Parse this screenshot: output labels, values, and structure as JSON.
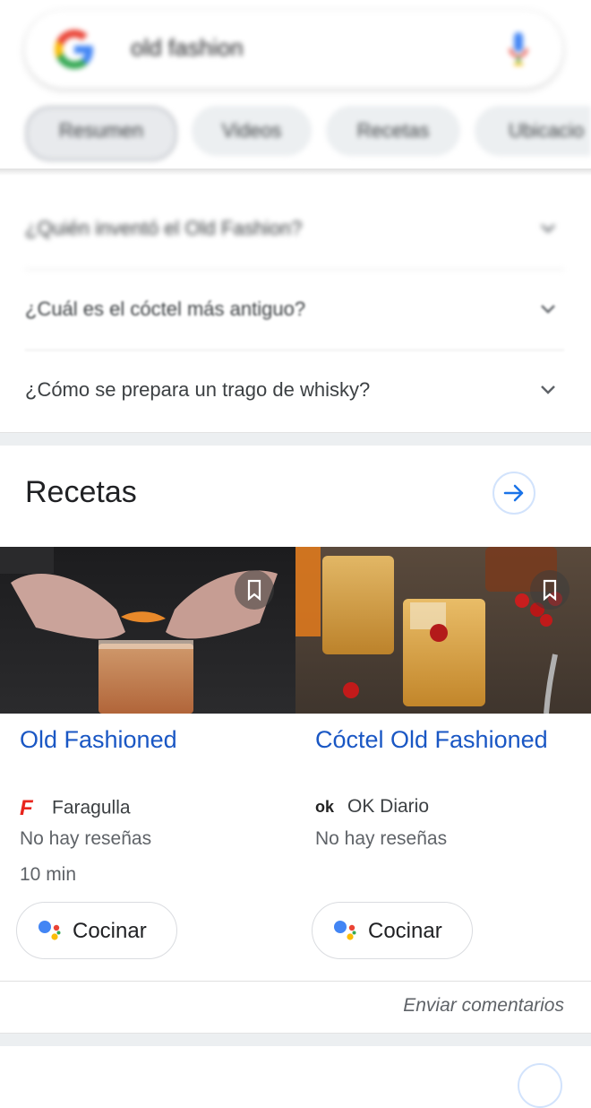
{
  "search": {
    "query": "old fashion"
  },
  "chips": [
    "Resumen",
    "Videos",
    "Recetas",
    "Ubicacio"
  ],
  "faq": [
    "¿Quién inventó el Old Fashion?",
    "¿Cuál es el cóctel más antiguo?",
    "¿Cómo se prepara un trago de whisky?"
  ],
  "recipes": {
    "title": "Recetas",
    "cards": [
      {
        "title": "Old Fashioned",
        "source": "Faragulla",
        "reviews": "No hay reseñas",
        "time": "10 min",
        "button": "Cocinar",
        "logo_text": "F"
      },
      {
        "title": "Cóctel Old Fashioned",
        "source": "OK Diario",
        "reviews": "No hay reseñas",
        "time": "",
        "button": "Cocinar",
        "logo_text": "ok"
      }
    ]
  },
  "feedback": "Enviar comentarios",
  "colors": {
    "link_blue": "#1a57c4",
    "google_blue": "#4285f4",
    "google_red": "#ea4335",
    "google_yellow": "#fbbc05",
    "google_green": "#34a853"
  }
}
